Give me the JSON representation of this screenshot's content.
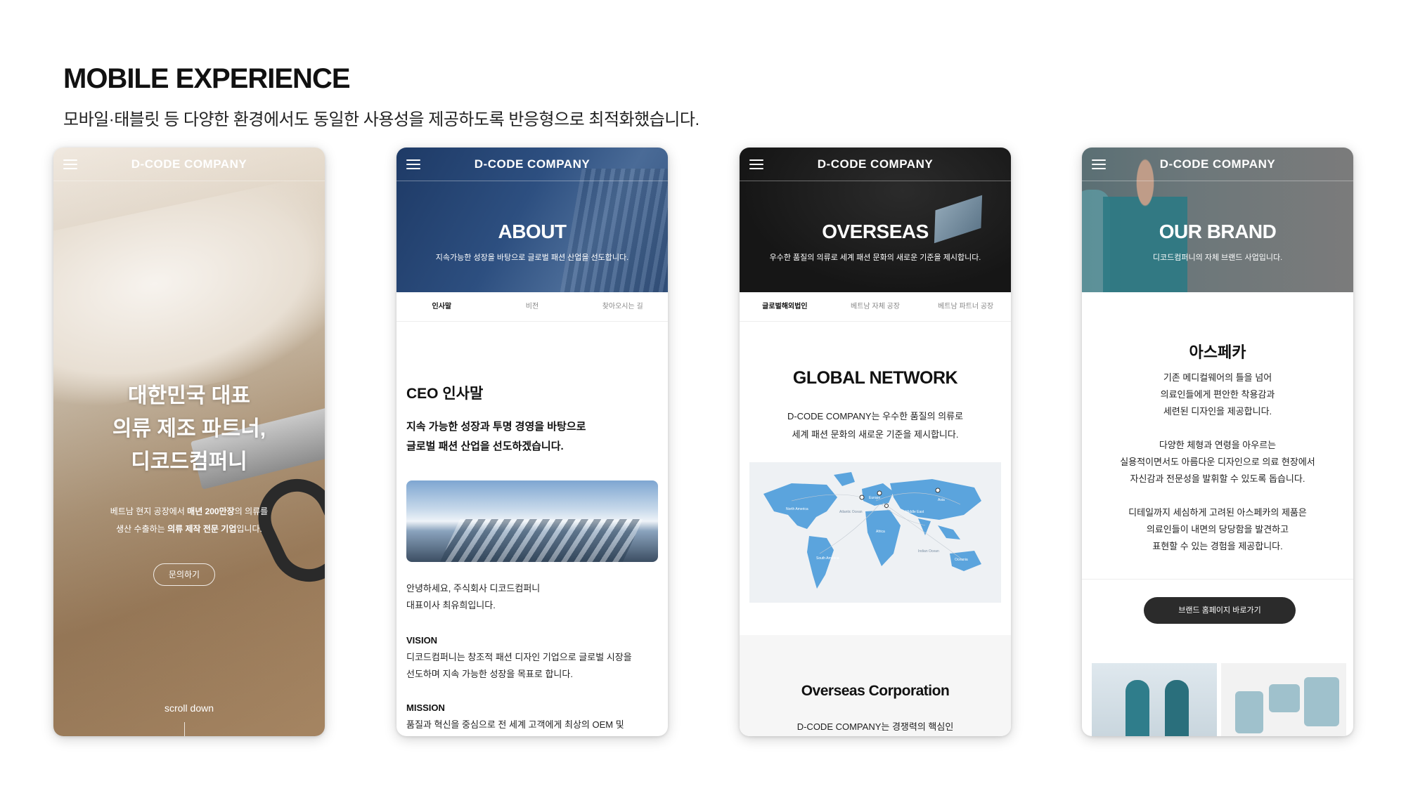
{
  "page": {
    "heading": "MOBILE EXPERIENCE",
    "subheading": "모바일·태블릿 등 다양한 환경에서도 동일한 사용성을 제공하도록 반응형으로 최적화했습니다."
  },
  "brand": "D-CODE COMPANY",
  "screen1": {
    "title_line1": "대한민국 대표",
    "title_line2": "의류 제조 파트너,",
    "title_line3": "디코드컴퍼니",
    "desc_line1_pre": "베트남 현지 공장에서 ",
    "desc_line1_bold": "매년 200만장",
    "desc_line1_post": "의 의류를",
    "desc_line2_pre": "생산 수출하는 ",
    "desc_line2_bold": "의류 제작 전문 기업",
    "desc_line2_post": "입니다.",
    "button": "문의하기",
    "scroll": "scroll down"
  },
  "screen2": {
    "hero_title": "ABOUT",
    "hero_desc": "지속가능한 성장을 바탕으로 글로벌 패션 산업을 선도합니다.",
    "tabs": [
      "인사말",
      "비전",
      "찾아오시는 길"
    ],
    "section_title": "CEO 인사말",
    "lead_line1": "지속 가능한 성장과 투명 경영을 바탕으로",
    "lead_line2": "글로벌 패션 산업을 선도하겠습니다.",
    "greet_line1": "안녕하세요, 주식회사 디코드컴퍼니",
    "greet_line2": "대표이사 최유희입니다.",
    "vision_label": "VISION",
    "vision_line1": "디코드컴퍼니는 창조적 패션 디자인 기업으로 글로벌 시장을",
    "vision_line2": "선도하며 지속 가능한 성장을 목표로 합니다.",
    "mission_label": "MISSION",
    "mission_line1": "품질과 혁신을 중심으로 전 세계 고객에게 최상의 OEM 및"
  },
  "screen3": {
    "hero_title": "OVERSEAS",
    "hero_desc": "우수한 품질의 의류로 세계 패션 문화의 새로운 기준을 제시합니다.",
    "tabs": [
      "글로벌해외법인",
      "베트남 자체 공장",
      "베트남 파트너 공장"
    ],
    "section_title": "GLOBAL NETWORK",
    "desc_line1": "D-CODE COMPANY는 우수한 품질의 의류로",
    "desc_line2": "세계 패션 문화의 새로운 기준을 제시합니다.",
    "map_labels": {
      "na": "North America",
      "atlantic": "Atlantic Ocean",
      "europe": "Europe",
      "asia": "Asia",
      "middle_east": "Middle East",
      "africa": "Africa",
      "sa": "South America",
      "indian": "Indian Ocean",
      "oceania": "Oceania"
    },
    "corp_title": "Overseas Corporation",
    "corp_desc": "D-CODE COMPANY는 경쟁력의 핵심인"
  },
  "screen4": {
    "hero_title": "OUR BRAND",
    "hero_desc": "디코드컴퍼니의 자체 브랜드 사업입니다.",
    "brand_name": "아스페카",
    "p1_l1": "기존 메디컬웨어의 틀을 넘어",
    "p1_l2": "의료인들에게 편안한 착용감과",
    "p1_l3": "세련된 디자인을 제공합니다.",
    "p2_l1": "다양한 체형과 연령을 아우르는",
    "p2_l2": "실용적이면서도 아름다운 디자인으로 의료 현장에서",
    "p2_l3": "자신감과 전문성을 발휘할 수 있도록 돕습니다.",
    "p3_l1": "디테일까지 세심하게 고려된 아스페카의 제품은",
    "p3_l2": "의료인들이 내면의 당당함을 발견하고",
    "p3_l3": "표현할 수 있는 경험을 제공합니다.",
    "button": "브랜드 홈페이지 바로가기"
  },
  "colors": {
    "dark_button": "#2b2b2b",
    "map_land": "#5ba4dd",
    "about_blue": "#2d4f80"
  }
}
